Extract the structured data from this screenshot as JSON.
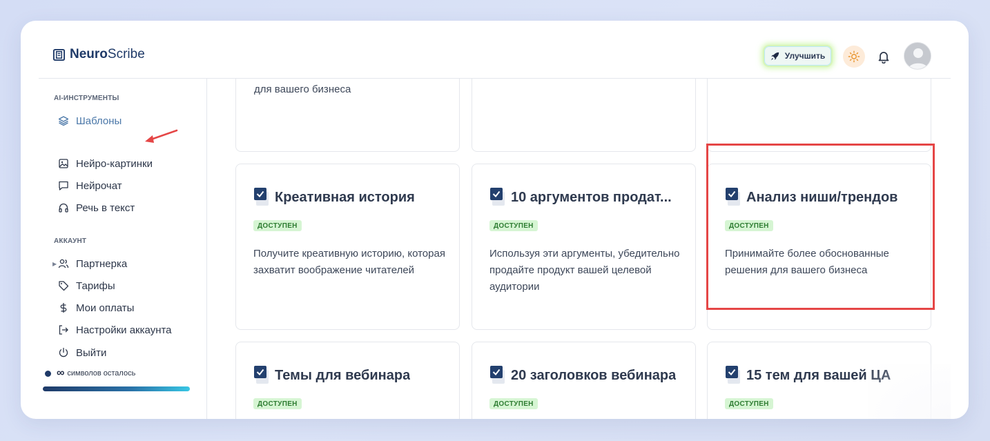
{
  "brand": {
    "name_bold": "Neuro",
    "name_regular": "Scribe"
  },
  "header": {
    "upgrade_label": "Улучшить"
  },
  "sidebar": {
    "section_tools": "AI-ИНСТРУМЕНТЫ",
    "tools": [
      {
        "label": "Шаблоны",
        "icon": "layers-icon",
        "active": true
      },
      {
        "label": "Нейро-картинки",
        "icon": "image-icon"
      },
      {
        "label": "Нейрочат",
        "icon": "chat-icon"
      },
      {
        "label": "Речь в текст",
        "icon": "headphones-icon"
      }
    ],
    "section_account": "АККАУНТ",
    "account": [
      {
        "label": "Партнерка",
        "icon": "users-icon"
      },
      {
        "label": "Тарифы",
        "icon": "tag-icon"
      },
      {
        "label": "Мои оплаты",
        "icon": "dollar-icon"
      },
      {
        "label": "Настройки аккаунта",
        "icon": "logout-arrow-icon"
      },
      {
        "label": "Выйти",
        "icon": "power-icon"
      }
    ],
    "credits": {
      "symbol": "∞",
      "label": "символов осталось"
    }
  },
  "cards_top_partial": [
    {
      "text": "для вашего бизнеса"
    },
    {
      "text": ""
    },
    {
      "text": ""
    }
  ],
  "cards": [
    {
      "title": "Креативная история",
      "badge": "ДОСТУПЕН",
      "description": "Получите креативную историю, которая захватит воображение читателей"
    },
    {
      "title": "10 аргументов продат...",
      "badge": "ДОСТУПЕН",
      "description": "Используя эти аргументы, убедительно продайте продукт вашей целевой аудитории"
    },
    {
      "title": "Анализ ниши/трендов",
      "badge": "ДОСТУПЕН",
      "description": "Принимайте более обоснованные решения для вашего бизнеса"
    },
    {
      "title": "Темы для вебинара",
      "badge": "ДОСТУПЕН",
      "description": ""
    },
    {
      "title": "20 заголовков вебинара",
      "badge": "ДОСТУПЕН",
      "description": ""
    },
    {
      "title": "15 тем для вашей ЦА",
      "badge": "ДОСТУПЕН",
      "description": ""
    }
  ],
  "colors": {
    "brand": "#1f3a68",
    "active_nav": "#4a77a8",
    "badge_bg": "#d6f5d3",
    "badge_text": "#2e7d32",
    "highlight": "#e54646"
  }
}
